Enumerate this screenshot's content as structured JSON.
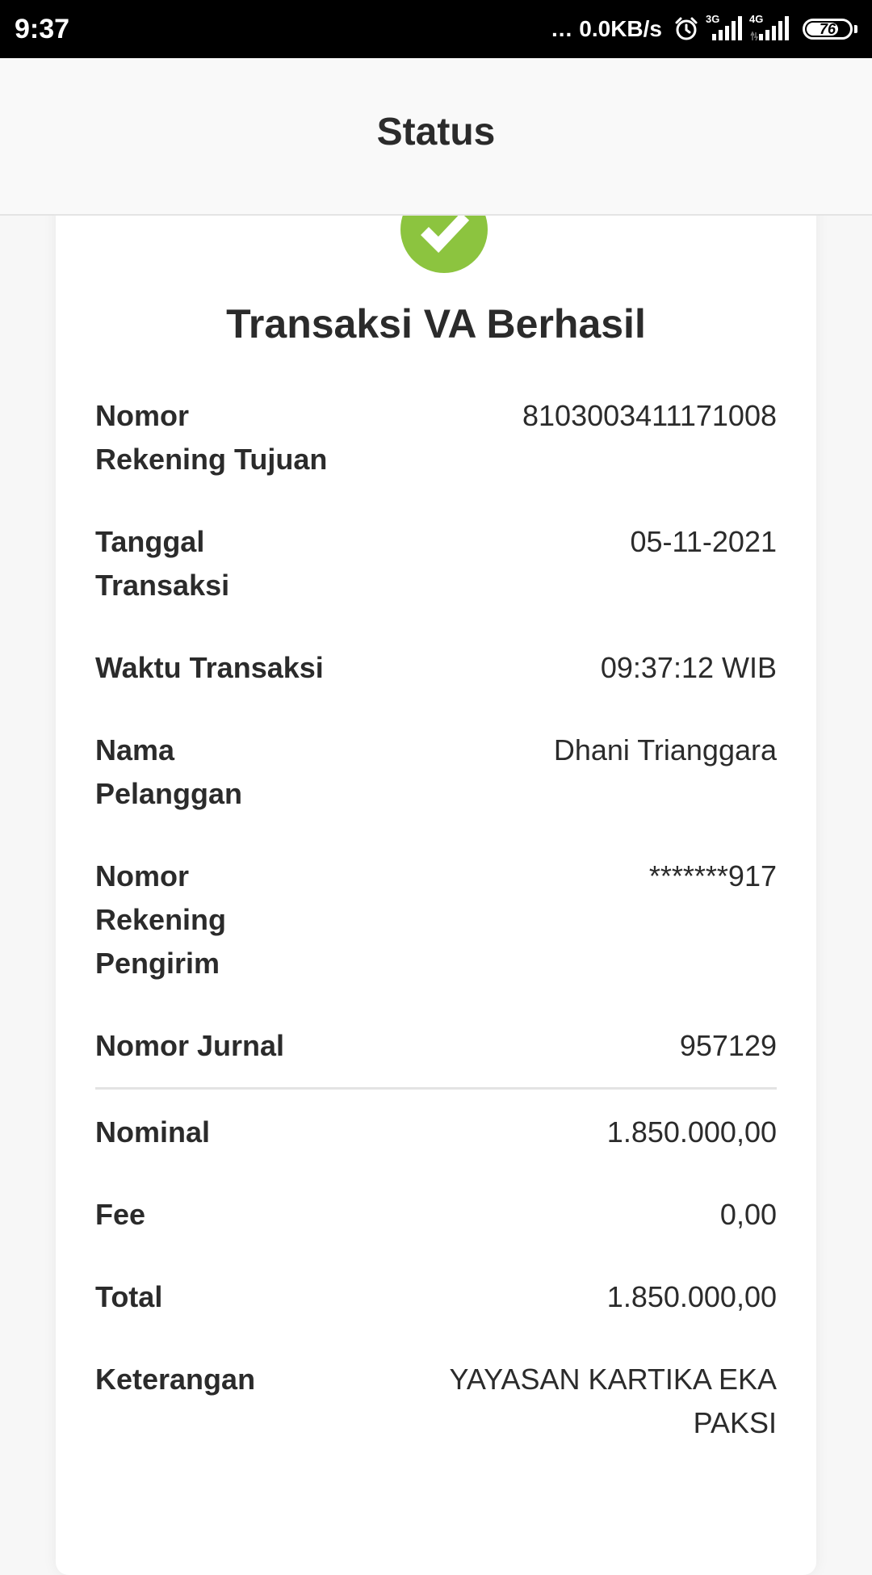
{
  "statusbar": {
    "time": "9:37",
    "dots": "...",
    "speed": "0.0KB/s",
    "sim1_tag": "3G",
    "sim2_tag": "4G",
    "battery": "76",
    "battery_level": 0.76
  },
  "header": {
    "title": "Status"
  },
  "result": {
    "icon": "check-circle-icon",
    "icon_color": "#8cc43f",
    "title": "Transaksi VA Berhasil"
  },
  "details": [
    {
      "label": "Nomor\nRekening Tujuan",
      "value": "8103003411171008"
    },
    {
      "label": "Tanggal\nTransaksi",
      "value": "05-11-2021"
    },
    {
      "label": "Waktu Transaksi",
      "value": "09:37:12 WIB"
    },
    {
      "label": "Nama\nPelanggan",
      "value": "Dhani Trianggara"
    },
    {
      "label": "Nomor\nRekening\nPengirim",
      "value": "*******917"
    },
    {
      "label": "Nomor Jurnal",
      "value": "957129"
    }
  ],
  "amounts": [
    {
      "label": "Nominal",
      "value": "1.850.000,00"
    },
    {
      "label": "Fee",
      "value": "0,00"
    },
    {
      "label": "Total",
      "value": "1.850.000,00"
    },
    {
      "label": "Keterangan",
      "value": "YAYASAN KARTIKA EKA\nPAKSI"
    }
  ]
}
